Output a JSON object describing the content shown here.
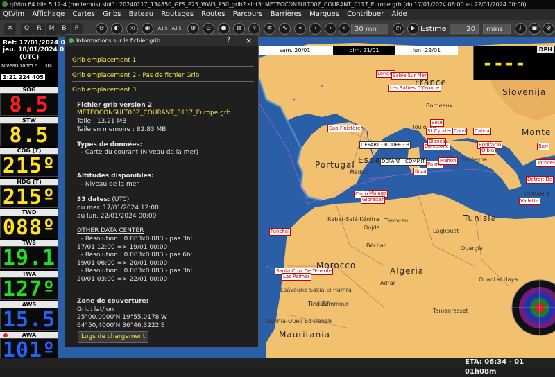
{
  "titlebar": {
    "text": "qtVlm 64 bits 5.12-4 (meltemus) slot1: 20240117_134850_GFS_P25_WW3_P50_grib2 slot3: METEOCONSULT00Z_COURANT_0117_Europe.grb (du 17/01/2024 06:00 au 22/01/2024 00:00)"
  },
  "menu": [
    "QtVlm",
    "Affichage",
    "Cartes",
    "Gribs",
    "Bateau",
    "Routages",
    "Routes",
    "Parcours",
    "Barrières",
    "Marques",
    "Contribuer",
    "Aide"
  ],
  "toolbar": {
    "letters": [
      "O",
      "R",
      "M",
      "B",
      "P"
    ],
    "ais_label": "A.I.S",
    "step_value": "30 mn",
    "estime_label": "Estime",
    "estime_value": "20",
    "unit_value": "mins"
  },
  "left_panel": {
    "ref_date": "Réf: 17/01/2024 06",
    "current_date": "jeu. 18/01/2024 05",
    "tz": "(UTC)",
    "zoom": "Niveau zoom 5",
    "zoom_val": "300",
    "scale": "1:21 224 405",
    "instruments": [
      {
        "label": "SOG",
        "value": "8.5",
        "color": "#ff1e1e"
      },
      {
        "label": "STW",
        "value": "8.5",
        "color": "#ffe11e"
      },
      {
        "label": "COG (T)",
        "value": "215º",
        "color": "#ffe11e"
      },
      {
        "label": "HDG (T)",
        "value": "215º",
        "color": "#ffe11e"
      },
      {
        "label": "TWD",
        "value": "088º",
        "color": "#ffe11e"
      },
      {
        "label": "TWS",
        "value": "19.1",
        "color": "#1ee11e"
      },
      {
        "label": "TWA",
        "value": "127º",
        "color": "#1ee11e"
      },
      {
        "label": "AWS",
        "value": "15.5",
        "color": "#1e64ff"
      },
      {
        "label": "AWA",
        "value": "101º",
        "color": "#1e64ff"
      }
    ]
  },
  "map": {
    "dates": [
      "sam. 20/01",
      "dim. 21/01",
      "lun. 22/01"
    ],
    "dph_label": "DPH",
    "dph_value": "----",
    "countries": [
      "France",
      "Slovenija",
      "Portugal",
      "Espa",
      "Tunisia",
      "Algeria",
      "Morocco",
      "Mauritania",
      "Monte",
      "IONIAN S"
    ],
    "places": [
      "Lorient",
      "Sable Sur Mer",
      "Les Sables D'Olonne",
      "Cap Finistère",
      "Sète",
      "St Cyprien",
      "Barcelone",
      "Blanes",
      "Calvi",
      "Calvia",
      "Bonifacio",
      "Olbia",
      "Bari",
      "Torricella",
      "DÉPART - BOUÉE - B",
      "DÉPART - COMMIT",
      "Palma",
      "Ibiza",
      "Mahon",
      "Détroit De",
      "Valletta",
      "Cadix",
      "Malaga",
      "Gibraltar",
      "Funchal",
      "Santa Cruz De Tenerife",
      "Las Palmas"
    ],
    "cities": [
      "Bordeaux",
      "Toulouse",
      "Madrid",
      "Sardegna",
      "Rabat-Salé-Kénitra",
      "Oujda",
      "Tlemcen",
      "Laghouat",
      "Ouargla",
      "Béchar",
      "Tindouf",
      "Laâyoune-Sakia El Hamra",
      "Tiris Zemmour",
      "Dakhla-Oued Ed-Dahab",
      "Adrar",
      "Tamanrasset",
      "Ouadi al Haya"
    ]
  },
  "dialog": {
    "title": "Informations sur le fichier grib",
    "help": "?",
    "close": "×",
    "slots": [
      "Grib emplacement 1",
      "Grib emplacement 2 - Pas de fichier Grib",
      "Grib emplacement 3"
    ],
    "file_heading": "Fichier grib version 2",
    "file_name": "METEOCONSULT00Z_COURANT_0117_Europe.grb",
    "size": "Taile : 13.21 MB",
    "mem": "Taile en memoire : 82.83 MB",
    "types_heading": "Types de données:",
    "types_item": "  - Carte du courant (Niveau de la mer)",
    "alt_heading": "Altitudes disponibles:",
    "alt_item": "  - Niveau de la mer",
    "dates_count": "33 dates:",
    "dates_tz": " (UTC)",
    "dates_from": "du mer. 17/01/2024 12:00",
    "dates_to": "au lun. 22/01/2024 00:00",
    "center_heading": "OTHER DATA CENTER",
    "res1": "  - Résolution : 0.083x0.083 - pas 3h:",
    "res1_range": "17/01 12:00 => 19/01 00:00",
    "res2": "  - Résolution : 0.083x0.083 - pas 6h:",
    "res2_range": "19/01 06:00 => 20/01 00:00",
    "res3": "  - Résolution : 0.083x0.083 - pas 3h:",
    "res3_range": "20/01 03:00 => 22/01 00:00",
    "zone_heading": "Zone de couverture:",
    "grid": "Grid: lat/lon",
    "corner1": "25°00,0000'N 19°55,0178'W",
    "corner2": "64°50,4000'N 36°46,3222'E",
    "log_button": "Logs de chargement"
  },
  "status": {
    "eta": "ETA: 06:34 - 01 01h08m"
  }
}
